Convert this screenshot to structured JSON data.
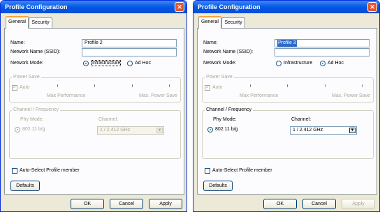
{
  "windows": [
    {
      "title": "Profile Configuration",
      "tabs": [
        "General",
        "Security"
      ],
      "name_label": "Name:",
      "name_value": "Profile 2",
      "ssid_label": "Network Name (SSID):",
      "ssid_value": "",
      "mode_label": "Network Mode:",
      "mode_infrastructure": "Infrastructure",
      "mode_adhoc": "Ad Hoc",
      "selected_mode": "infrastructure",
      "power_save_title": "Power Save",
      "auto_label": "Auto",
      "max_performance": "Max Performance",
      "max_power_save": "Max. Power Save",
      "channel_title": "Channel / Frequency",
      "phy_mode_label": "Phy Mode:",
      "phy_mode_value": "802.11 b/g",
      "channel_label": "Channel:",
      "channel_value": "1 / 2.412 GHz",
      "channel_enabled": false,
      "auto_select_label": "Auto-Select Profile member",
      "defaults_button": "Defaults",
      "ok_button": "OK",
      "cancel_button": "Cancel",
      "apply_button": "Apply",
      "apply_enabled": true
    },
    {
      "title": "Profile Configuration",
      "tabs": [
        "General",
        "Security"
      ],
      "name_label": "Name:",
      "name_value": "Profile 3",
      "ssid_label": "Network Name (SSID):",
      "ssid_value": "",
      "mode_label": "Network Mode:",
      "mode_infrastructure": "Infrastructure",
      "mode_adhoc": "Ad Hoc",
      "selected_mode": "adhoc",
      "power_save_title": "Power Save",
      "auto_label": "Auto",
      "max_performance": "Max Performance",
      "max_power_save": "Max. Power Save",
      "channel_title": "Channel / Frequency",
      "phy_mode_label": "Phy Mode:",
      "phy_mode_value": "802.11 b/g",
      "channel_label": "Channel:",
      "channel_value": "1 / 2.412 GHz",
      "channel_enabled": true,
      "auto_select_label": "Auto-Select Profile member",
      "defaults_button": "Defaults",
      "ok_button": "OK",
      "cancel_button": "Cancel",
      "apply_button": "Apply",
      "apply_enabled": false
    }
  ]
}
